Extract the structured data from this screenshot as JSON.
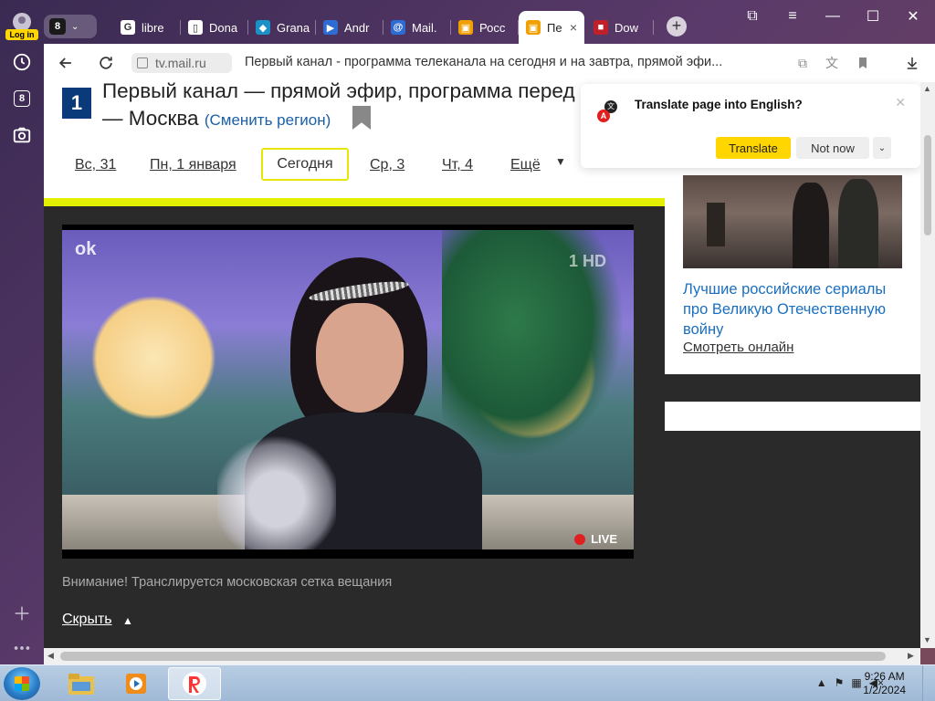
{
  "sidebar": {
    "login_badge": "Log in",
    "tabs_number": "8"
  },
  "tabstrip": {
    "tab_count": "8",
    "tabs": [
      {
        "label": "libre",
        "fav_color": "#ffffff",
        "fav_glyph": "G"
      },
      {
        "label": "Dona",
        "fav_color": "#ffffff",
        "fav_glyph": "▯"
      },
      {
        "label": "Grana",
        "fav_color": "#1e90c8",
        "fav_glyph": "◆"
      },
      {
        "label": "Andr",
        "fav_color": "#2e6bd3",
        "fav_glyph": "▶"
      },
      {
        "label": "Mail.",
        "fav_color": "#2e6bd3",
        "fav_glyph": "@"
      },
      {
        "label": "Росс",
        "fav_color": "#f0a000",
        "fav_glyph": "▣"
      },
      {
        "label": "Пе",
        "fav_color": "#f0a000",
        "fav_glyph": "▣",
        "active": true,
        "close": "×"
      },
      {
        "label": "Dow",
        "fav_color": "#c0202a",
        "fav_glyph": "■"
      }
    ],
    "new_tab": "+"
  },
  "window": {
    "minimize": "—",
    "maximize": "☐",
    "close": "✕",
    "menu": "≡",
    "bookmarks": "⧉"
  },
  "toolbar": {
    "domain": "tv.mail.ru",
    "page_title": "Первый канал - программа телеканала на сегодня и на завтра, прямой эфи..."
  },
  "header": {
    "title": "Первый канал — прямой эфир, программа перед",
    "title_line2": "— Москва",
    "region_link": "(Сменить регион)",
    "logo": "1"
  },
  "days": [
    {
      "label": "Вс, 31"
    },
    {
      "label": "Пн, 1 января"
    },
    {
      "label": "Сегодня",
      "current": true
    },
    {
      "label": "Ср, 3"
    },
    {
      "label": "Чт, 4"
    },
    {
      "label": "Ещё"
    }
  ],
  "video": {
    "live_label": "LIVE",
    "ok_mark": "ok",
    "hd_mark": "1 HD"
  },
  "notice": "Внимание! Транслируется московская сетка вещания",
  "hide_link": "Скрыть",
  "promo": {
    "title": "Лучшие российские сериалы про Великую Отечественную войну",
    "watch_link": "Смотреть онлайн"
  },
  "translate_popup": {
    "question": "Translate page into English?",
    "translate_button": "Translate",
    "not_now_button": "Not now",
    "more": "⌄",
    "close": "✕"
  },
  "taskbar": {
    "time": "9:26 AM",
    "date": "1/2/2024"
  },
  "colors": {
    "accent_yellow": "#ffd600",
    "link_blue": "#1a6fc0",
    "schedule_bar": "#e5ef00"
  }
}
